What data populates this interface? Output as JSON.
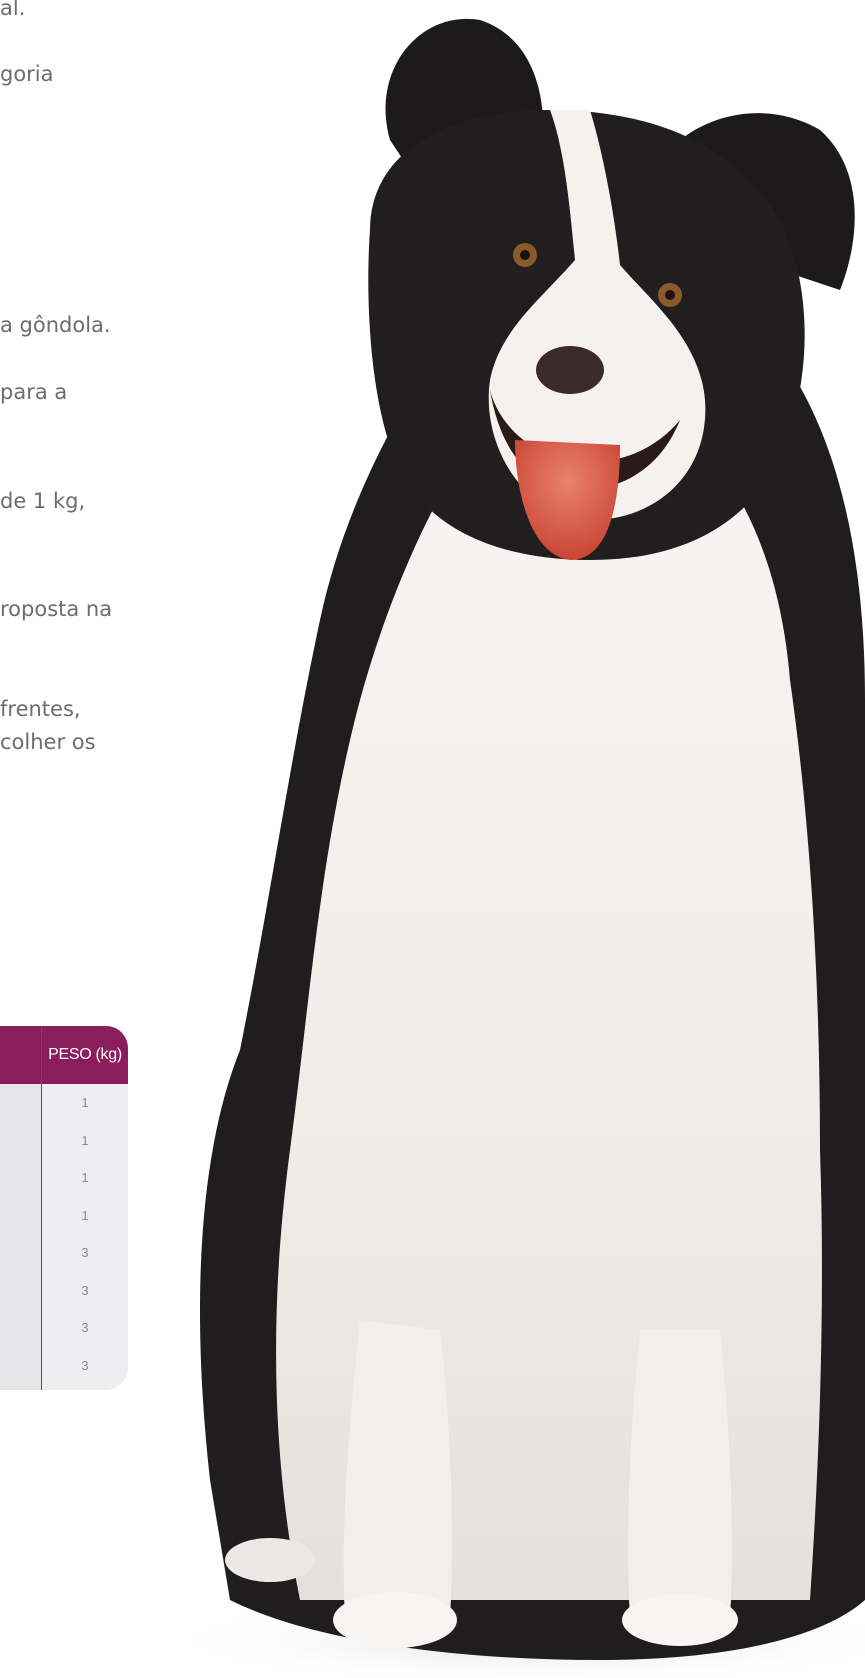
{
  "paragraph_fragments": [
    "al.",
    "goria",
    "a gôndola.",
    "para a",
    "de 1 kg,",
    "roposta na",
    "frentes,",
    "colher os"
  ],
  "table": {
    "peso_header": "PESO (kg)",
    "peso_values": [
      "1",
      "1",
      "1",
      "1",
      "3",
      "3",
      "3",
      "3"
    ],
    "header_color": "#8a1e5c",
    "body_color": "#eeeef0"
  },
  "image": {
    "subject": "border-collie-dog",
    "icon": "dog-photo"
  }
}
